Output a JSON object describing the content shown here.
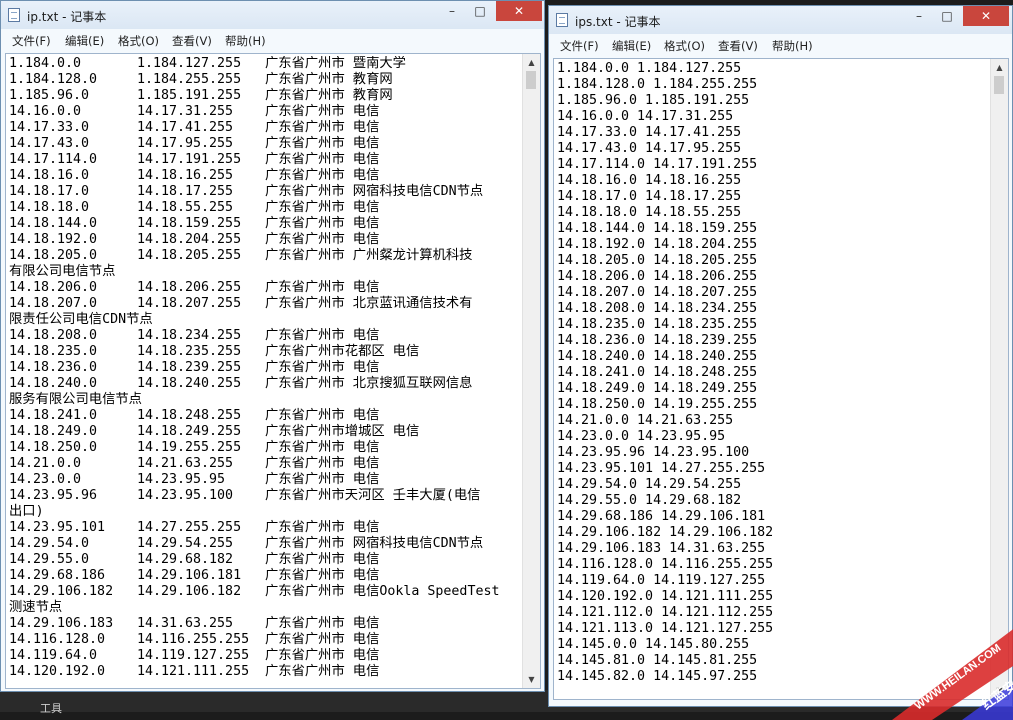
{
  "taskbar": {
    "label": "工具"
  },
  "win_left": {
    "title": "ip.txt - 记事本",
    "controls": {
      "min": "–",
      "max": "□",
      "close": "✕"
    },
    "menu": [
      "文件(F)",
      "编辑(E)",
      "格式(O)",
      "查看(V)",
      "帮助(H)"
    ],
    "lines": [
      [
        "1.184.0.0",
        "1.184.127.255",
        "广东省广州市 暨南大学"
      ],
      [
        "1.184.128.0",
        "1.184.255.255",
        "广东省广州市 教育网"
      ],
      [
        "1.185.96.0",
        "1.185.191.255",
        "广东省广州市 教育网"
      ],
      [
        "14.16.0.0",
        "14.17.31.255",
        "广东省广州市 电信"
      ],
      [
        "14.17.33.0",
        "14.17.41.255",
        "广东省广州市 电信"
      ],
      [
        "14.17.43.0",
        "14.17.95.255",
        "广东省广州市 电信"
      ],
      [
        "14.17.114.0",
        "14.17.191.255",
        "广东省广州市 电信"
      ],
      [
        "14.18.16.0",
        "14.18.16.255",
        "广东省广州市 电信"
      ],
      [
        "14.18.17.0",
        "14.18.17.255",
        "广东省广州市 网宿科技电信CDN节点"
      ],
      [
        "14.18.18.0",
        "14.18.55.255",
        "广东省广州市 电信"
      ],
      [
        "14.18.144.0",
        "14.18.159.255",
        "广东省广州市 电信"
      ],
      [
        "14.18.192.0",
        "14.18.204.255",
        "广东省广州市 电信"
      ],
      [
        "14.18.205.0",
        "14.18.205.255",
        "广东省广州市 广州粲龙计算机科技"
      ],
      [
        "有限公司电信节点",
        "",
        ""
      ],
      [
        "14.18.206.0",
        "14.18.206.255",
        "广东省广州市 电信"
      ],
      [
        "14.18.207.0",
        "14.18.207.255",
        "广东省广州市 北京蓝讯通信技术有"
      ],
      [
        "限责任公司电信CDN节点",
        "",
        ""
      ],
      [
        "14.18.208.0",
        "14.18.234.255",
        "广东省广州市 电信"
      ],
      [
        "14.18.235.0",
        "14.18.235.255",
        "广东省广州市花都区 电信"
      ],
      [
        "14.18.236.0",
        "14.18.239.255",
        "广东省广州市 电信"
      ],
      [
        "14.18.240.0",
        "14.18.240.255",
        "广东省广州市 北京搜狐互联网信息"
      ],
      [
        "服务有限公司电信节点",
        "",
        ""
      ],
      [
        "14.18.241.0",
        "14.18.248.255",
        "广东省广州市 电信"
      ],
      [
        "14.18.249.0",
        "14.18.249.255",
        "广东省广州市增城区 电信"
      ],
      [
        "14.18.250.0",
        "14.19.255.255",
        "广东省广州市 电信"
      ],
      [
        "14.21.0.0",
        "14.21.63.255",
        "广东省广州市 电信"
      ],
      [
        "14.23.0.0",
        "14.23.95.95",
        "广东省广州市 电信"
      ],
      [
        "14.23.95.96",
        "14.23.95.100",
        "广东省广州市天河区 壬丰大厦(电信"
      ],
      [
        "出口)",
        "",
        ""
      ],
      [
        "14.23.95.101",
        "14.27.255.255",
        "广东省广州市 电信"
      ],
      [
        "14.29.54.0",
        "14.29.54.255",
        "广东省广州市 网宿科技电信CDN节点"
      ],
      [
        "14.29.55.0",
        "14.29.68.182",
        "广东省广州市 电信"
      ],
      [
        "14.29.68.186",
        "14.29.106.181",
        "广东省广州市 电信"
      ],
      [
        "14.29.106.182",
        "14.29.106.182",
        "广东省广州市 电信Ookla SpeedTest"
      ],
      [
        "测速节点",
        "",
        ""
      ],
      [
        "14.29.106.183",
        "14.31.63.255",
        "广东省广州市 电信"
      ],
      [
        "14.116.128.0",
        "14.116.255.255",
        "广东省广州市 电信"
      ],
      [
        "14.119.64.0",
        "14.119.127.255",
        "广东省广州市 电信"
      ],
      [
        "14.120.192.0",
        "14.121.111.255",
        "广东省广州市 电信"
      ]
    ]
  },
  "win_right": {
    "title": "ips.txt - 记事本",
    "controls": {
      "min": "–",
      "max": "□",
      "close": "✕"
    },
    "menu": [
      "文件(F)",
      "编辑(E)",
      "格式(O)",
      "查看(V)",
      "帮助(H)"
    ],
    "lines": [
      "1.184.0.0 1.184.127.255",
      "1.184.128.0 1.184.255.255",
      "1.185.96.0 1.185.191.255",
      "14.16.0.0 14.17.31.255",
      "14.17.33.0 14.17.41.255",
      "14.17.43.0 14.17.95.255",
      "14.17.114.0 14.17.191.255",
      "14.18.16.0 14.18.16.255",
      "14.18.17.0 14.18.17.255",
      "14.18.18.0 14.18.55.255",
      "14.18.144.0 14.18.159.255",
      "14.18.192.0 14.18.204.255",
      "14.18.205.0 14.18.205.255",
      "14.18.206.0 14.18.206.255",
      "14.18.207.0 14.18.207.255",
      "14.18.208.0 14.18.234.255",
      "14.18.235.0 14.18.235.255",
      "14.18.236.0 14.18.239.255",
      "14.18.240.0 14.18.240.255",
      "14.18.241.0 14.18.248.255",
      "14.18.249.0 14.18.249.255",
      "14.18.250.0 14.19.255.255",
      "14.21.0.0 14.21.63.255",
      "14.23.0.0 14.23.95.95",
      "14.23.95.96 14.23.95.100",
      "14.23.95.101 14.27.255.255",
      "14.29.54.0 14.29.54.255",
      "14.29.55.0 14.29.68.182",
      "14.29.68.186 14.29.106.181",
      "14.29.106.182 14.29.106.182",
      "14.29.106.183 14.31.63.255",
      "14.116.128.0 14.116.255.255",
      "14.119.64.0 14.119.127.255",
      "14.120.192.0 14.121.111.255",
      "14.121.112.0 14.121.112.255",
      "14.121.113.0 14.121.127.255",
      "14.145.0.0 14.145.80.255",
      "14.145.81.0 14.145.81.255",
      "14.145.82.0 14.145.97.255"
    ]
  },
  "watermark": {
    "url": "WWW.HEILAN.COM",
    "text": "红蓝安全网",
    "colors": [
      "#d92b2b",
      "#3a3adb"
    ]
  }
}
